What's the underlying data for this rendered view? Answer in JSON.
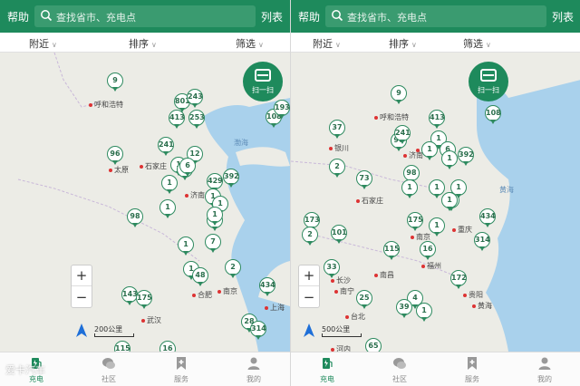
{
  "screens": [
    {
      "topbar": {
        "help": "帮助",
        "search_placeholder": "查找省市、充电点",
        "list": "列表"
      },
      "filters": [
        "附近",
        "排序",
        "筛选"
      ],
      "scan_label": "扫一扫",
      "scale_label": "200公里",
      "pins": [
        "9",
        "801",
        "243",
        "413",
        "253",
        "108",
        "193",
        "96",
        "12",
        "241",
        "1",
        "1",
        "6",
        "1",
        "429",
        "392",
        "1",
        "1",
        "1",
        "1",
        "98",
        "1",
        "1",
        "7",
        "1",
        "2",
        "48",
        "434",
        "143",
        "175",
        "28",
        "314",
        "115",
        "16"
      ],
      "cities": [
        "呼和浩特",
        "太原",
        "石家庄",
        "济南",
        "合肥",
        "南京",
        "上海",
        "武汉",
        "渤海"
      ]
    },
    {
      "topbar": {
        "help": "帮助",
        "search_placeholder": "查找省市、充电点",
        "list": "列表"
      },
      "filters": [
        "附近",
        "排序",
        "筛选"
      ],
      "scan_label": "扫一扫",
      "scale_label": "500公里",
      "pins": [
        "9",
        "108",
        "413",
        "96",
        "37",
        "241",
        "1",
        "1",
        "6",
        "73",
        "98",
        "1",
        "2",
        "1",
        "1",
        "392",
        "1",
        "1",
        "173",
        "2",
        "101",
        "175",
        "1",
        "1",
        "434",
        "314",
        "115",
        "16",
        "33",
        "172",
        "25",
        "4",
        "39",
        "1",
        "65"
      ],
      "cities": [
        "呼和浩特",
        "银川",
        "西安",
        "石家庄",
        "济南",
        "武汉",
        "南京",
        "重庆",
        "长沙",
        "南昌",
        "福州",
        "贵阳",
        "南宁",
        "台北",
        "黄海",
        "河内"
      ]
    }
  ],
  "tabs": [
    {
      "label": "充电",
      "icon": "charging-station-icon",
      "active": true
    },
    {
      "label": "社区",
      "icon": "chat-bubbles-icon",
      "active": false
    },
    {
      "label": "服务",
      "icon": "service-bookmark-icon",
      "active": false
    },
    {
      "label": "我的",
      "icon": "user-icon",
      "active": false
    }
  ],
  "watermark": "爱卡汽车",
  "colors": {
    "brand": "#1e8a5c",
    "pin": "#2e8a5f",
    "sea": "#a9d1ec",
    "land": "#ecece6"
  }
}
